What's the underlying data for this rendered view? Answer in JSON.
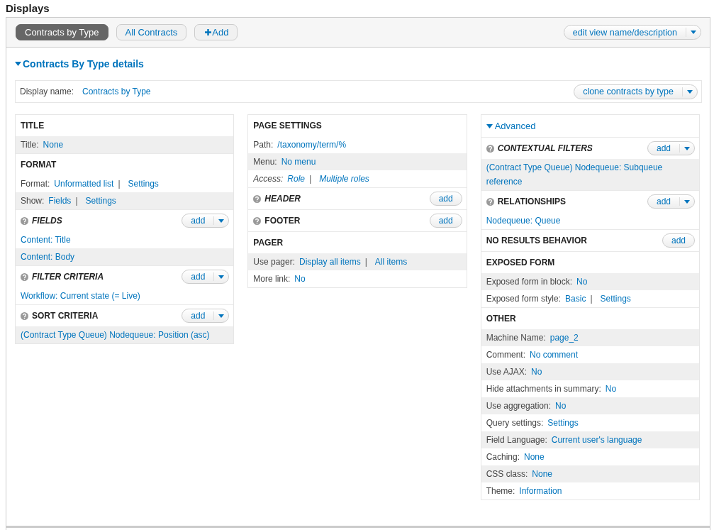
{
  "page_title": "Displays",
  "display_tabs": [
    {
      "label": "Contracts by Type",
      "selected": true
    },
    {
      "label": "All Contracts",
      "selected": false
    }
  ],
  "add_display_button": {
    "label": "Add"
  },
  "edit_view_button": {
    "label": "edit view name/description",
    "dropdown": true
  },
  "details": {
    "title": "Contracts By Type details",
    "expanded": true,
    "display_name": {
      "label": "Display name:",
      "value": "Contracts by Type"
    },
    "clone_button": {
      "label": "clone contracts by type",
      "dropdown": true
    },
    "columns": [
      {
        "sections": [
          {
            "title": "TITLE",
            "help": false,
            "overridden": false,
            "rows": [
              {
                "label": "Title:",
                "links": [
                  "None"
                ],
                "shaded": true,
                "overridden": false
              }
            ]
          },
          {
            "title": "FORMAT",
            "help": false,
            "overridden": false,
            "rows": [
              {
                "label": "Format:",
                "links": [
                  "Unformatted list",
                  "Settings"
                ],
                "separator": "|",
                "shaded": false,
                "overridden": false
              },
              {
                "label": "Show:",
                "links": [
                  "Fields",
                  "Settings"
                ],
                "separator": "|",
                "shaded": true,
                "overridden": false
              }
            ]
          },
          {
            "title": "FIELDS",
            "help": true,
            "overridden": true,
            "add_button": {
              "label": "add",
              "dropdown": true
            },
            "rows": [
              {
                "links": [
                  "Content: Title"
                ],
                "shaded": false,
                "overridden": false
              },
              {
                "links": [
                  "Content: Body"
                ],
                "shaded": true,
                "overridden": false
              }
            ]
          },
          {
            "title": "FILTER CRITERIA",
            "help": true,
            "overridden": true,
            "add_button": {
              "label": "add",
              "dropdown": true
            },
            "rows": [
              {
                "links": [
                  "Workflow: Current state (= Live)"
                ],
                "shaded": false,
                "overridden": false
              }
            ]
          },
          {
            "title": "SORT CRITERIA",
            "help": true,
            "overridden": false,
            "add_button": {
              "label": "add",
              "dropdown": true
            },
            "rows": [
              {
                "links": [
                  "(Contract Type Queue) Nodequeue: Position (asc)"
                ],
                "shaded": true,
                "overridden": false
              }
            ]
          }
        ]
      },
      {
        "sections": [
          {
            "title": "PAGE SETTINGS",
            "help": false,
            "overridden": false,
            "rows": [
              {
                "label": "Path:",
                "links": [
                  "/taxonomy/term/%"
                ],
                "shaded": false,
                "overridden": false
              },
              {
                "label": "Menu:",
                "links": [
                  "No menu"
                ],
                "shaded": true,
                "overridden": false
              },
              {
                "label": "Access:",
                "links": [
                  "Role",
                  "Multiple roles"
                ],
                "separator": "|",
                "shaded": false,
                "overridden": true
              }
            ]
          },
          {
            "title": "HEADER",
            "help": true,
            "overridden": true,
            "add_button": {
              "label": "add",
              "dropdown": false
            }
          },
          {
            "title": "FOOTER",
            "help": true,
            "overridden": false,
            "add_button": {
              "label": "add",
              "dropdown": false
            }
          },
          {
            "title": "PAGER",
            "help": false,
            "overridden": false,
            "rows": [
              {
                "label": "Use pager:",
                "links": [
                  "Display all items",
                  "All items"
                ],
                "separator": "|",
                "shaded": true,
                "overridden": false
              },
              {
                "label": "More link:",
                "links": [
                  "No"
                ],
                "shaded": false,
                "overridden": false
              }
            ]
          }
        ]
      },
      {
        "toggle": {
          "label": "Advanced",
          "expanded": true
        },
        "sections": [
          {
            "title": "CONTEXTUAL FILTERS",
            "help": true,
            "overridden": true,
            "add_button": {
              "label": "add",
              "dropdown": true
            },
            "rows": [
              {
                "links": [
                  "(Contract Type Queue) Nodequeue: Subqueue reference"
                ],
                "shaded": true,
                "overridden": false
              }
            ]
          },
          {
            "title": "RELATIONSHIPS",
            "help": true,
            "overridden": false,
            "add_button": {
              "label": "add",
              "dropdown": true
            },
            "rows": [
              {
                "links": [
                  "Nodequeue: Queue"
                ],
                "shaded": false,
                "overridden": false
              }
            ]
          },
          {
            "title": "NO RESULTS BEHAVIOR",
            "help": false,
            "overridden": false,
            "add_button": {
              "label": "add",
              "dropdown": false
            }
          },
          {
            "title": "EXPOSED FORM",
            "help": false,
            "overridden": false,
            "rows": [
              {
                "label": "Exposed form in block:",
                "links": [
                  "No"
                ],
                "shaded": true,
                "overridden": false
              },
              {
                "label": "Exposed form style:",
                "links": [
                  "Basic",
                  "Settings"
                ],
                "separator": "|",
                "shaded": false,
                "overridden": false
              }
            ]
          },
          {
            "title": "OTHER",
            "help": false,
            "overridden": false,
            "rows": [
              {
                "label": "Machine Name:",
                "links": [
                  "page_2"
                ],
                "shaded": true,
                "overridden": false
              },
              {
                "label": "Comment:",
                "links": [
                  "No comment"
                ],
                "shaded": false,
                "overridden": false
              },
              {
                "label": "Use AJAX:",
                "links": [
                  "No"
                ],
                "shaded": true,
                "overridden": false
              },
              {
                "label": "Hide attachments in summary:",
                "links": [
                  "No"
                ],
                "shaded": false,
                "overridden": false
              },
              {
                "label": "Use aggregation:",
                "links": [
                  "No"
                ],
                "shaded": true,
                "overridden": false
              },
              {
                "label": "Query settings:",
                "links": [
                  "Settings"
                ],
                "shaded": false,
                "overridden": false
              },
              {
                "label": "Field Language:",
                "links": [
                  "Current user's language"
                ],
                "shaded": true,
                "overridden": false
              },
              {
                "label": "Caching:",
                "links": [
                  "None"
                ],
                "shaded": false,
                "overridden": false
              },
              {
                "label": "CSS class:",
                "links": [
                  "None"
                ],
                "shaded": true,
                "overridden": false
              },
              {
                "label": "Theme:",
                "links": [
                  "Information"
                ],
                "shaded": false,
                "overridden": false
              }
            ]
          }
        ]
      }
    ]
  }
}
